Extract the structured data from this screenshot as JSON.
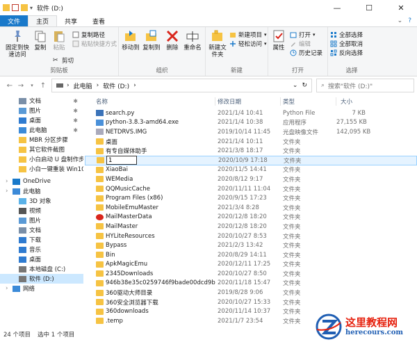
{
  "window": {
    "title": "软件 (D:)",
    "controls": [
      "—",
      "☐",
      "✕"
    ]
  },
  "tabs": [
    "文件",
    "主页",
    "共享",
    "查看"
  ],
  "ribbon": {
    "clipboard": {
      "pin": "固定到快速访问",
      "copy": "复制",
      "paste": "粘贴",
      "copy_path": "复制路径",
      "paste_shortcut": "粘贴快捷方式",
      "cut": "剪切",
      "label": "剪贴板"
    },
    "organize": {
      "move_to": "移动到",
      "copy_to": "复制到",
      "delete": "删除",
      "rename": "重命名",
      "label": "组织"
    },
    "new": {
      "new_folder": "新建文件夹",
      "new_item": "新建项目",
      "easy_access": "轻松访问",
      "label": "新建"
    },
    "open": {
      "properties": "属性",
      "open": "打开",
      "edit": "编辑",
      "history": "历史记录",
      "label": "打开"
    },
    "select": {
      "select_all": "全部选择",
      "select_none": "全部取消",
      "invert": "反向选择",
      "label": "选择"
    }
  },
  "address": {
    "crumbs": [
      "此电脑",
      "软件 (D:)"
    ],
    "search_placeholder": "搜索\"软件 (D:)\""
  },
  "nav": [
    {
      "label": "文档",
      "pinned": true,
      "icon": "documents-icon"
    },
    {
      "label": "图片",
      "pinned": true,
      "icon": "pictures-icon"
    },
    {
      "label": "桌面",
      "pinned": true,
      "icon": "desktop-icon"
    },
    {
      "label": "此电脑",
      "pinned": true,
      "icon": "computer-icon"
    },
    {
      "label": "MBR 分区步骤",
      "pinned": false,
      "icon": "folder-icon"
    },
    {
      "label": "其它软件截图",
      "pinned": false,
      "icon": "folder-icon"
    },
    {
      "label": "小白启动 U 盘制作步",
      "pinned": false,
      "icon": "folder-icon"
    },
    {
      "label": "小白一键重装 Win10",
      "pinned": false,
      "icon": "folder-icon"
    },
    {
      "label": "OneDrive",
      "pinned": false,
      "icon": "onedrive-icon",
      "level0": true
    },
    {
      "label": "此电脑",
      "pinned": false,
      "icon": "computer-icon",
      "level0": true
    },
    {
      "label": "3D 对象",
      "pinned": false,
      "icon": "3d-objects-icon"
    },
    {
      "label": "视频",
      "pinned": false,
      "icon": "videos-icon"
    },
    {
      "label": "图片",
      "pinned": false,
      "icon": "pictures-icon"
    },
    {
      "label": "文档",
      "pinned": false,
      "icon": "documents-icon"
    },
    {
      "label": "下载",
      "pinned": false,
      "icon": "downloads-icon"
    },
    {
      "label": "音乐",
      "pinned": false,
      "icon": "music-icon"
    },
    {
      "label": "桌面",
      "pinned": false,
      "icon": "desktop-icon"
    },
    {
      "label": "本地磁盘 (C:)",
      "pinned": false,
      "icon": "drive-icon"
    },
    {
      "label": "软件 (D:)",
      "pinned": false,
      "icon": "drive-icon",
      "selected": true
    },
    {
      "label": "网络",
      "pinned": false,
      "icon": "network-icon",
      "level0": true
    }
  ],
  "columns": [
    "名称",
    "修改日期",
    "类型",
    "大小"
  ],
  "files": [
    {
      "name": "search.py",
      "date": "2021/1/4 10:41",
      "type": "Python File",
      "size": "7 KB",
      "kind": "py"
    },
    {
      "name": "python-3.8.3-amd64.exe",
      "date": "2021/1/4 10:38",
      "type": "应用程序",
      "size": "27,155 KB",
      "kind": "exe"
    },
    {
      "name": "NETDRVS.IMG",
      "date": "2019/10/14 11:45",
      "type": "光盘映像文件",
      "size": "142,095 KB",
      "kind": "img"
    },
    {
      "name": "桌面",
      "date": "2021/1/4 10:11",
      "type": "文件夹",
      "size": "",
      "kind": "folder"
    },
    {
      "name": "有专自媒体助手",
      "date": "2021/3/8 18:17",
      "type": "文件夹",
      "size": "",
      "kind": "folder"
    },
    {
      "name": "1",
      "date": "2020/10/9 17:18",
      "type": "文件夹",
      "size": "",
      "kind": "folder",
      "renaming": true
    },
    {
      "name": "XiaoBai",
      "date": "2020/11/5 14:41",
      "type": "文件夹",
      "size": "",
      "kind": "folder"
    },
    {
      "name": "WEMedia",
      "date": "2020/8/12 9:17",
      "type": "文件夹",
      "size": "",
      "kind": "folder"
    },
    {
      "name": "QQMusicCache",
      "date": "2020/11/11 11:04",
      "type": "文件夹",
      "size": "",
      "kind": "folder"
    },
    {
      "name": "Program Files (x86)",
      "date": "2020/9/15 17:23",
      "type": "文件夹",
      "size": "",
      "kind": "folder"
    },
    {
      "name": "MobileEmuMaster",
      "date": "2021/3/4 8:28",
      "type": "文件夹",
      "size": "",
      "kind": "folder"
    },
    {
      "name": "MailMasterData",
      "date": "2020/12/8 18:20",
      "type": "文件夹",
      "size": "",
      "kind": "mail"
    },
    {
      "name": "MailMaster",
      "date": "2020/12/8 18:20",
      "type": "文件夹",
      "size": "",
      "kind": "folder"
    },
    {
      "name": "HYLiteResources",
      "date": "2020/10/27 8:53",
      "type": "文件夹",
      "size": "",
      "kind": "folder"
    },
    {
      "name": "Bypass",
      "date": "2021/2/3 13:42",
      "type": "文件夹",
      "size": "",
      "kind": "folder"
    },
    {
      "name": "Bin",
      "date": "2020/8/29 14:11",
      "type": "文件夹",
      "size": "",
      "kind": "folder"
    },
    {
      "name": "ApkMagicEmu",
      "date": "2020/12/11 17:25",
      "type": "文件夹",
      "size": "",
      "kind": "folder"
    },
    {
      "name": "2345Downloads",
      "date": "2020/10/27 8:50",
      "type": "文件夹",
      "size": "",
      "kind": "folder"
    },
    {
      "name": "946b38e35c0259746f9bade00dcd9b8b",
      "date": "2020/11/18 15:47",
      "type": "文件夹",
      "size": "",
      "kind": "folder"
    },
    {
      "name": "360驱动大师目录",
      "date": "2019/8/28 9:06",
      "type": "文件夹",
      "size": "",
      "kind": "folder"
    },
    {
      "name": "360安全浏览器下载",
      "date": "2020/10/27 15:33",
      "type": "文件夹",
      "size": "",
      "kind": "folder"
    },
    {
      "name": "360downloads",
      "date": "2020/11/14 10:37",
      "type": "文件夹",
      "size": "",
      "kind": "folder"
    },
    {
      "name": ".temp",
      "date": "2021/1/7 23:54",
      "type": "文件夹",
      "size": "",
      "kind": "folder"
    }
  ],
  "status": {
    "count": "24 个项目",
    "selected": "选中 1 个项目"
  },
  "watermark": {
    "title": "这里教程网",
    "url": "herecours.com"
  },
  "colors": {
    "file_tab": "#1979ca",
    "selection": "#cce8ff",
    "folder": "#f6c343",
    "watermark_red": "#e6210e",
    "watermark_blue": "#1f5eb3"
  }
}
